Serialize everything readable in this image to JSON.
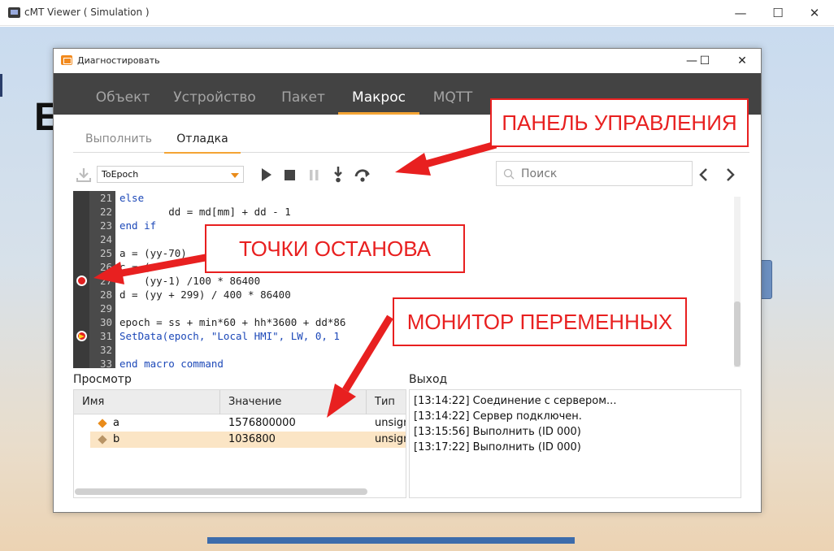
{
  "outer_window": {
    "title": "cMT Viewer ( Simulation )",
    "minimize": "—",
    "maximize": "☐",
    "close": "✕",
    "background_letter": "E"
  },
  "dialog": {
    "title": "Диагностировать",
    "minimize": "—",
    "maximize": "☐",
    "close": "✕"
  },
  "main_tabs": [
    {
      "label": "Объект",
      "active": false
    },
    {
      "label": "Устройство",
      "active": false
    },
    {
      "label": "Пакет",
      "active": false
    },
    {
      "label": "Макрос",
      "active": true
    },
    {
      "label": "MQTT",
      "active": false
    }
  ],
  "sub_tabs": [
    {
      "label": "Выполнить",
      "active": false
    },
    {
      "label": "Отладка",
      "active": true
    }
  ],
  "toolbar": {
    "macro_selected": "ToEpoch",
    "search_placeholder": "Поиск",
    "icons": [
      "download-icon",
      "play-icon",
      "stop-icon",
      "pause-icon",
      "step-into-icon",
      "step-over-icon"
    ]
  },
  "code_lines": [
    {
      "num": "21",
      "text": "else",
      "keyword": true,
      "breakpoint": "none"
    },
    {
      "num": "22",
      "text": "        dd = md[mm] + dd - 1",
      "keyword": false,
      "breakpoint": "none"
    },
    {
      "num": "23",
      "text": "end if",
      "keyword": true,
      "breakpoint": "none"
    },
    {
      "num": "24",
      "text": "",
      "keyword": false,
      "breakpoint": "none"
    },
    {
      "num": "25",
      "text": "a = (yy-70)",
      "keyword": false,
      "breakpoint": "none"
    },
    {
      "num": "26",
      "text": "c = (",
      "keyword": false,
      "breakpoint": "none"
    },
    {
      "num": "27",
      "text": "    (yy-1) /100 * 86400",
      "keyword": false,
      "breakpoint": "set"
    },
    {
      "num": "28",
      "text": "d = (yy + 299) / 400 * 86400",
      "keyword": false,
      "breakpoint": "none"
    },
    {
      "num": "29",
      "text": "",
      "keyword": false,
      "breakpoint": "none"
    },
    {
      "num": "30",
      "text": "epoch = ss + min*60 + hh*3600 + dd*86",
      "keyword": false,
      "breakpoint": "none"
    },
    {
      "num": "31",
      "text": "SetData(epoch, \"Local HMI\", LW, 0, 1",
      "keyword": true,
      "breakpoint": "current"
    },
    {
      "num": "32",
      "text": "",
      "keyword": false,
      "breakpoint": "none"
    },
    {
      "num": "33",
      "text": "end macro_command",
      "keyword": true,
      "breakpoint": "none"
    }
  ],
  "watch": {
    "label": "Просмотр",
    "columns": [
      "Имя",
      "Значение",
      "Тип"
    ],
    "rows": [
      {
        "name": "a",
        "value": "1576800000",
        "type": "unsign",
        "selected": false
      },
      {
        "name": "b",
        "value": "1036800",
        "type": "unsign",
        "selected": true
      }
    ]
  },
  "output": {
    "label": "Выход",
    "lines": [
      "[13:14:22] Соединение с сервером...",
      "[13:14:22] Сервер подключен.",
      "[13:15:56] Выполнить (ID 000)",
      "[13:17:22] Выполнить (ID 000)"
    ]
  },
  "annotations": {
    "control_panel": "ПАНЕЛЬ УПРАВЛЕНИЯ",
    "breakpoints": "ТОЧКИ ОСТАНОВА",
    "variable_monitor": "МОНИТОР ПЕРЕМЕННЫХ"
  },
  "colors": {
    "accent": "#f4a434",
    "tabbar": "#434343",
    "callout_red": "#e82020",
    "keyword_blue": "#1c48b8"
  }
}
